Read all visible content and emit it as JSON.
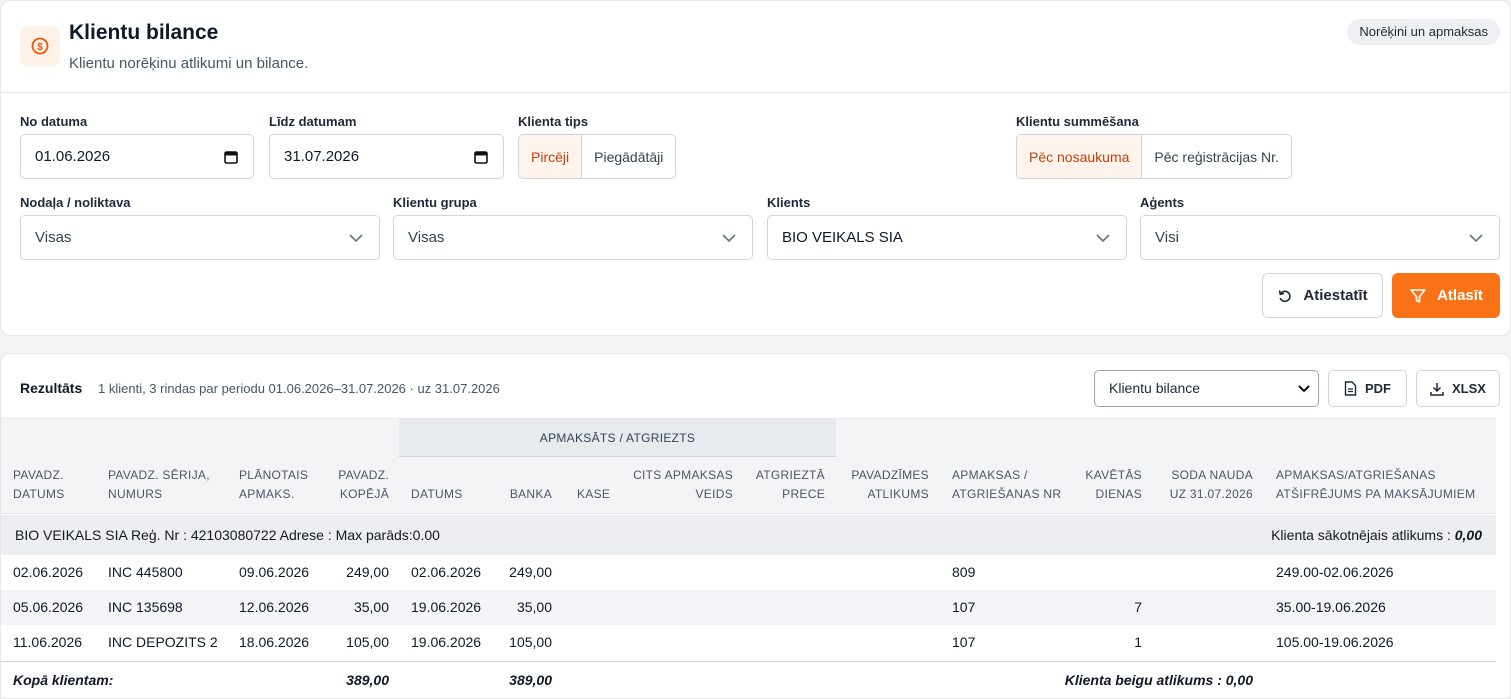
{
  "header": {
    "title": "Klientu bilance",
    "subtitle": "Klientu norēķinu atlikumi un bilance.",
    "badge": "Norēķini un apmaksas",
    "icon": "dollar-coin-icon",
    "accent": "#f97316"
  },
  "filters": {
    "date_from": {
      "label": "No datuma",
      "value": "01.06.2026"
    },
    "date_to": {
      "label": "Līdz datumam",
      "value": "31.07.2026"
    },
    "client_type": {
      "label": "Klienta tips",
      "options": [
        "Pircēji",
        "Piegādātāji"
      ],
      "selected": "Pircēji"
    },
    "client_sum": {
      "label": "Klientu summēšana",
      "options": [
        "Pēc nosaukuma",
        "Pēc reģistrācijas Nr."
      ],
      "selected": "Pēc nosaukuma"
    },
    "department": {
      "label": "Nodaļa / noliktava",
      "value": "Visas"
    },
    "client_group": {
      "label": "Klientu grupa",
      "value": "Visas"
    },
    "client": {
      "label": "Klients",
      "value": "BIO VEIKALS SIA"
    },
    "agent": {
      "label": "Aģents",
      "value": "Visi"
    },
    "reset_label": "Atiestatīt",
    "apply_label": "Atlasīt"
  },
  "results": {
    "title": "Rezultāts",
    "meta": "1 klienti, 3 rindas par periodu 01.06.2026–31.07.2026 · uz 31.07.2026",
    "report_select": "Klientu bilance",
    "pdf_label": "PDF",
    "xlsx_label": "XLSX",
    "group_header": "APMAKSĀTS / ATGRIEZTS",
    "columns": {
      "doc_date": [
        "PAVADZ.",
        "DATUMS"
      ],
      "doc_series": [
        "PAVADZ. SĒRIJA,",
        "NUMURS"
      ],
      "planned": [
        "PLĀNOTAIS",
        "APMAKS."
      ],
      "doc_total": [
        "PAVADZ.",
        "KOPĒJĀ"
      ],
      "pay_date": "DATUMS",
      "bank": "BANKA",
      "cash": "KASE",
      "other": [
        "CITS APMAKSAS",
        "VEIDS"
      ],
      "returned": [
        "ATGRIEZTĀ",
        "PRECE"
      ],
      "balance": [
        "PAVADZĪMES",
        "ATLIKUMS"
      ],
      "pay_nr": [
        "APMAKSAS /",
        "ATGRIEŠANAS NR"
      ],
      "late": [
        "KAVĒTĀS",
        "DIENAS"
      ],
      "penalty": [
        "SODA NAUDA",
        "UZ 31.07.2026"
      ],
      "decode": [
        "APMAKSAS/ATGRIEŠANAS",
        "ATŠIFRĒJUMS PA MAKSĀJUMIEM"
      ]
    },
    "client_row": {
      "text": "BIO VEIKALS SIA Reģ. Nr : 42103080722 Adrese : Max parāds:0.00",
      "opening_label": "Klienta sākotnējais atlikums :",
      "opening_value": "0,00"
    },
    "rows": [
      {
        "doc_date": "02.06.2026",
        "doc_series": "INC 445800",
        "planned": "09.06.2026",
        "doc_total": "249,00",
        "pay_date": "02.06.2026",
        "bank": "249,00",
        "pay_nr": "809",
        "late": "",
        "decode": "249.00-02.06.2026"
      },
      {
        "doc_date": "05.06.2026",
        "doc_series": "INC 135698",
        "planned": "12.06.2026",
        "doc_total": "35,00",
        "pay_date": "19.06.2026",
        "bank": "35,00",
        "pay_nr": "107",
        "late": "7",
        "decode": "35.00-19.06.2026"
      },
      {
        "doc_date": "11.06.2026",
        "doc_series": "INC DEPOZITS 2",
        "planned": "18.06.2026",
        "doc_total": "105,00",
        "pay_date": "19.06.2026",
        "bank": "105,00",
        "pay_nr": "107",
        "late": "1",
        "decode": "105.00-19.06.2026"
      }
    ],
    "totals": {
      "label": "Kopā klientam:",
      "doc_total": "389,00",
      "bank": "389,00",
      "closing_label": "Klienta beigu atlikums :",
      "closing_value": "0,00"
    }
  }
}
